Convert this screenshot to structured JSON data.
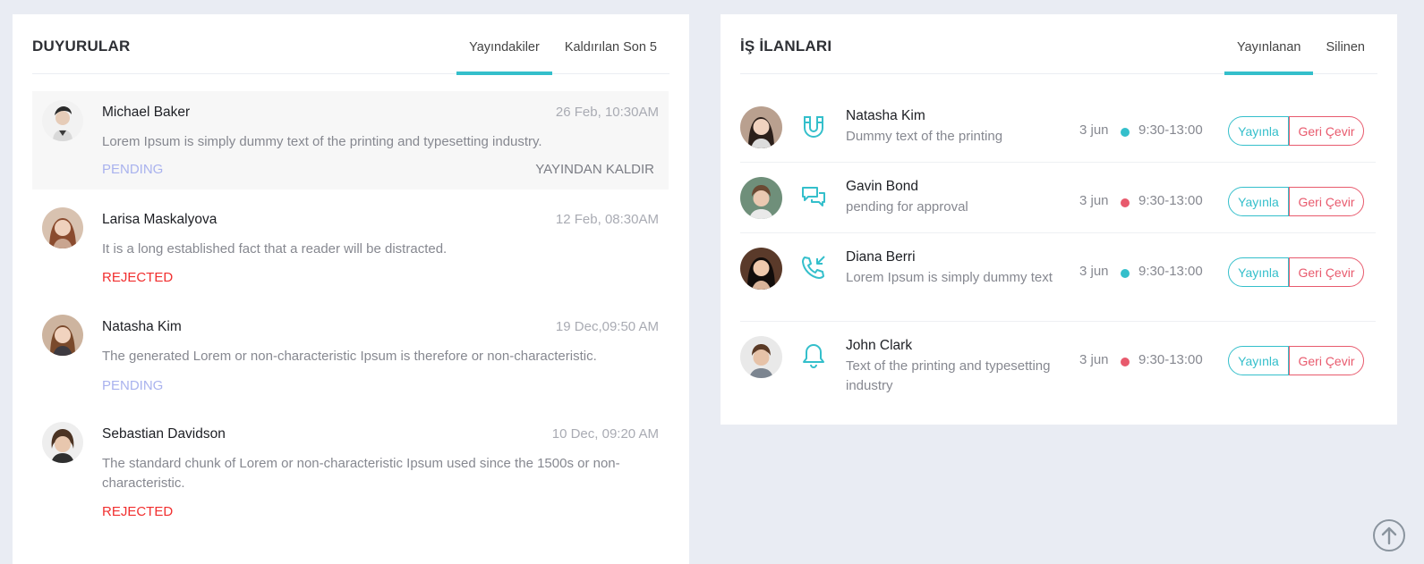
{
  "announcements": {
    "title": "DUYURULAR",
    "tabs": [
      {
        "label": "Yayındakiler",
        "active": true
      },
      {
        "label": "Kaldırılan Son 5",
        "active": false
      }
    ],
    "items": [
      {
        "name": "Michael Baker",
        "time": "26 Feb, 10:30AM",
        "text": "Lorem Ipsum is simply dummy text of the printing and typesetting industry.",
        "status": "PENDING",
        "action": "YAYINDAN KALDIR"
      },
      {
        "name": "Larisa Maskalyova",
        "time": "12 Feb, 08:30AM",
        "text": "It is a long established fact that a reader will be distracted.",
        "status": "REJECTED"
      },
      {
        "name": "Natasha Kim",
        "time": "19 Dec,09:50 AM",
        "text": "The generated Lorem or non-characteristic Ipsum is therefore or non-characteristic.",
        "status": "PENDING"
      },
      {
        "name": "Sebastian Davidson",
        "time": "10 Dec, 09:20 AM",
        "text": "The standard chunk of Lorem or non-characteristic Ipsum used since the 1500s or non-characteristic.",
        "status": "REJECTED"
      }
    ]
  },
  "jobs": {
    "title": "İŞ İLANLARI",
    "tabs": [
      {
        "label": "Yayınlanan",
        "active": true
      },
      {
        "label": "Silinen",
        "active": false
      }
    ],
    "items": [
      {
        "name": "Natasha Kim",
        "desc": "Dummy text of the printing",
        "date": "3 jun",
        "time": "9:30-13:00",
        "icon": "magnet-icon",
        "dot_color": "#34bfcb"
      },
      {
        "name": "Gavin Bond",
        "desc": "pending for approval",
        "date": "3 jun",
        "time": "9:30-13:00",
        "icon": "chat-icon",
        "dot_color": "#e85a6d"
      },
      {
        "name": "Diana Berri",
        "desc": "Lorem Ipsum is simply dummy text",
        "date": "3 jun",
        "time": "9:30-13:00",
        "icon": "phone-incoming-icon",
        "dot_color": "#34bfcb"
      },
      {
        "name": "John Clark",
        "desc": "Text of the printing and typesetting industry",
        "date": "3 jun",
        "time": "9:30-13:00",
        "icon": "bell-icon",
        "dot_color": "#e85a6d"
      }
    ],
    "publish_label": "Yayınla",
    "reject_label": "Geri Çevir"
  },
  "colors": {
    "accent": "#34bfcb",
    "danger": "#e85a6d",
    "pending": "#a9b2ee",
    "rejected": "#f12f2f"
  }
}
